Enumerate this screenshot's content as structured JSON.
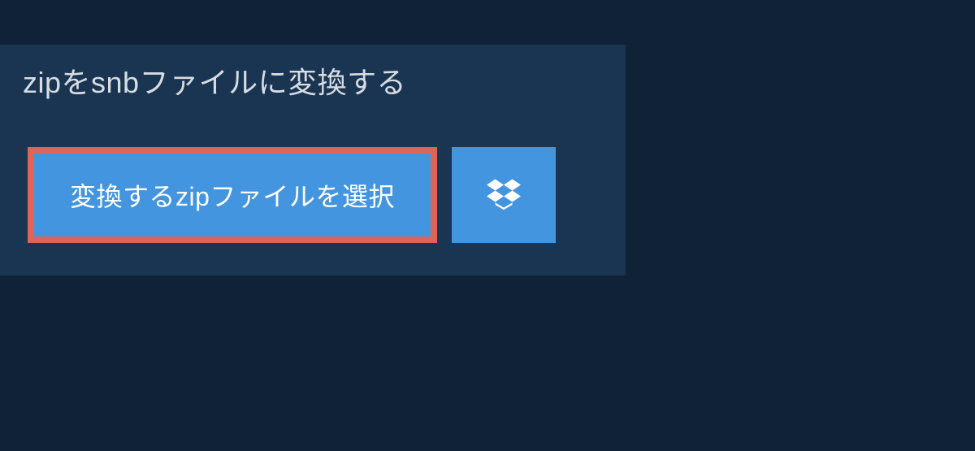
{
  "heading": "zipをsnbファイルに変換する",
  "buttons": {
    "select_file_label": "変換するzipファイルを選択"
  },
  "colors": {
    "background": "#0f2238",
    "panel": "#1a3552",
    "button": "#4295de",
    "highlight_border": "#de6459",
    "text_light": "#d8dde3"
  }
}
